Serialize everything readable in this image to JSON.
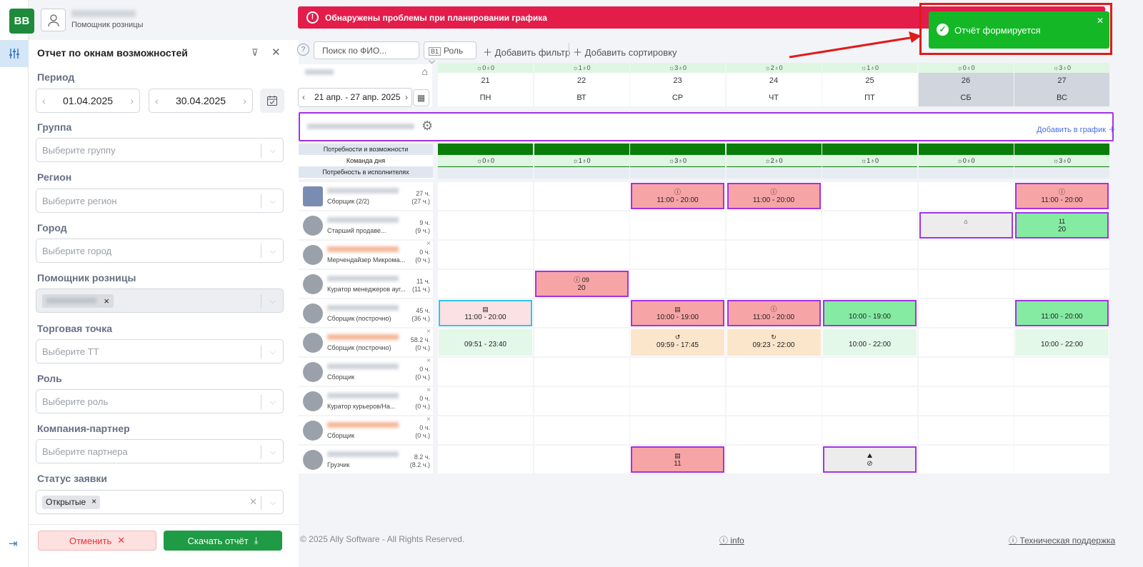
{
  "app": {
    "logo": "BB",
    "user_role": "Помощник розницы"
  },
  "panel": {
    "title": "Отчет по окнам возможностей",
    "period_label": "Период",
    "date_from": "01.04.2025",
    "date_to": "30.04.2025",
    "group_label": "Группа",
    "group_placeholder": "Выберите группу",
    "region_label": "Регион",
    "region_placeholder": "Выберите регион",
    "city_label": "Город",
    "city_placeholder": "Выберите город",
    "assistant_label": "Помощник розницы",
    "tt_label": "Торговая точка",
    "tt_placeholder": "Выберите ТТ",
    "role_label": "Роль",
    "role_placeholder": "Выберите роль",
    "partner_label": "Компания-партнер",
    "partner_placeholder": "Выберите партнера",
    "status_label": "Статус заявки",
    "status_tag": "Открытые",
    "cancel": "Отменить",
    "download": "Скачать отчёт"
  },
  "banner": "Обнаружены проблемы при планировании графика",
  "toast": "Отчёт формируется",
  "toolbar": {
    "help": "?",
    "search_placeholder": "Поиск по ФИО...",
    "role": "Роль",
    "add_filter": "Добавить фильтр",
    "add_sort": "Добавить сортировку"
  },
  "week": {
    "range": "21 апр. - 27 апр. 2025"
  },
  "days": [
    {
      "num": "21",
      "name": "ПН",
      "cap": "☼0♁0",
      "weekend": false
    },
    {
      "num": "22",
      "name": "ВТ",
      "cap": "☼1♁0",
      "weekend": false
    },
    {
      "num": "23",
      "name": "СР",
      "cap": "☼3♁0",
      "weekend": false
    },
    {
      "num": "24",
      "name": "ЧТ",
      "cap": "☼2♁0",
      "weekend": false
    },
    {
      "num": "25",
      "name": "ПТ",
      "cap": "☼1♁0",
      "weekend": false
    },
    {
      "num": "26",
      "name": "СБ",
      "cap": "☼0♁0",
      "weekend": true
    },
    {
      "num": "27",
      "name": "ВС",
      "cap": "☼3♁0",
      "weekend": true
    }
  ],
  "add_to_graph": "Добавить в график",
  "needs": {
    "r1": "Потребности и возможности",
    "r2": "Команда дня",
    "r3": "Потребность в исполнителях"
  },
  "employees": [
    {
      "role": "Сборщик (2/2)",
      "hours": "27 ч.",
      "hours2": "(27 ч.)"
    },
    {
      "role": "Старший продаве...",
      "hours": "9 ч.",
      "hours2": "(9 ч.)"
    },
    {
      "role": "Мерчендайзер Микрома...",
      "hours": "0 ч.",
      "hours2": "(0 ч.)"
    },
    {
      "role": "Куратор менеджеров ауг...",
      "hours": "11 ч.",
      "hours2": "(11 ч.)"
    },
    {
      "role": "Сборщик (построчно)",
      "hours": "45 ч.",
      "hours2": "(36 ч.)"
    },
    {
      "role": "Сборщик (построчно)",
      "hours": "58.2 ч.",
      "hours2": "(0 ч.)"
    },
    {
      "role": "Сборщик",
      "hours": "0 ч.",
      "hours2": "(0 ч.)"
    },
    {
      "role": "Куратор курьеров/На...",
      "hours": "0 ч.",
      "hours2": "(0 ч.)"
    },
    {
      "role": "Сборщик",
      "hours": "0 ч.",
      "hours2": "(0 ч.)"
    },
    {
      "role": "Грузчик",
      "hours": "8.2 ч.",
      "hours2": "(8.2 ч.)"
    }
  ],
  "shifts": [
    {
      "row": 0,
      "day": 2,
      "icon": "ⓘ",
      "text": "11:00 - 20:00",
      "style": "pink bp"
    },
    {
      "row": 0,
      "day": 3,
      "icon": "ⓘ",
      "text": "11:00 - 20:00",
      "style": "pink bp"
    },
    {
      "row": 0,
      "day": 6,
      "icon": "ⓘ",
      "text": "11:00 - 20:00",
      "style": "pink bp"
    },
    {
      "row": 1,
      "day": 5,
      "icon": "⌂",
      "text": "",
      "style": "grey bp"
    },
    {
      "row": 1,
      "day": 6,
      "icon": "11",
      "text": "20",
      "style": "green bp"
    },
    {
      "row": 3,
      "day": 1,
      "icon": "ⓘ 09",
      "text": "20",
      "style": "pink bp"
    },
    {
      "row": 4,
      "day": 0,
      "icon": "▤",
      "text": "11:00 - 20:00",
      "style": "lpink bc"
    },
    {
      "row": 4,
      "day": 2,
      "icon": "▤",
      "text": "10:00 - 19:00",
      "style": "pink bp"
    },
    {
      "row": 4,
      "day": 3,
      "icon": "ⓘ",
      "text": "11:00 - 20:00",
      "style": "pink bp"
    },
    {
      "row": 4,
      "day": 4,
      "icon": "",
      "text": "10:00 - 19:00",
      "style": "green bp"
    },
    {
      "row": 4,
      "day": 6,
      "icon": "",
      "text": "11:00 - 20:00",
      "style": "green bp"
    },
    {
      "row": 5,
      "day": 0,
      "icon": "",
      "text": "09:51 - 23:40",
      "style": "lgreen"
    },
    {
      "row": 5,
      "day": 2,
      "icon": "↺",
      "text": "09:59 - 17:45",
      "style": "peach"
    },
    {
      "row": 5,
      "day": 3,
      "icon": "↻",
      "text": "09:23 - 22:00",
      "style": "peach"
    },
    {
      "row": 5,
      "day": 4,
      "icon": "",
      "text": "10:00 - 22:00",
      "style": "lgreen"
    },
    {
      "row": 5,
      "day": 6,
      "icon": "",
      "text": "10:00 - 22:00",
      "style": "lgreen"
    },
    {
      "row": 9,
      "day": 2,
      "icon": "▤",
      "text": "11",
      "style": "pink bp"
    },
    {
      "row": 9,
      "day": 4,
      "icon": "⛰",
      "text": "⊘",
      "style": "grey bp"
    }
  ],
  "footer": {
    "copyright": "© 2025 Ally Software - All Rights Reserved.",
    "info": "info",
    "support": "Техническая поддержка"
  }
}
